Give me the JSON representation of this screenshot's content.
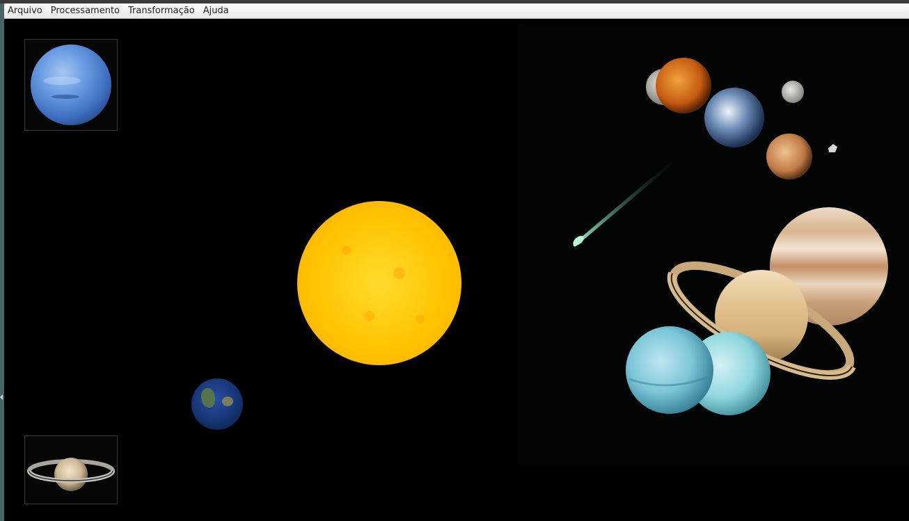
{
  "menu": {
    "file": "Arquivo",
    "processing": "Processamento",
    "transform": "Transformação",
    "help": "Ajuda"
  },
  "colors": {
    "canvas": "#000000",
    "sun": "#ffc400",
    "neptune": "#4f7fc8",
    "earth": "#1e3d7a",
    "uranus": "#8fd6e0",
    "jupiter": "#d9b48f",
    "saturn": "#e7c99a"
  },
  "images": {
    "neptune_thumb": "neptune-icon",
    "saturn_thumb": "saturn-icon",
    "sun": "sun-icon",
    "earth": "earth-icon",
    "solar_system": "solar-system-image"
  }
}
